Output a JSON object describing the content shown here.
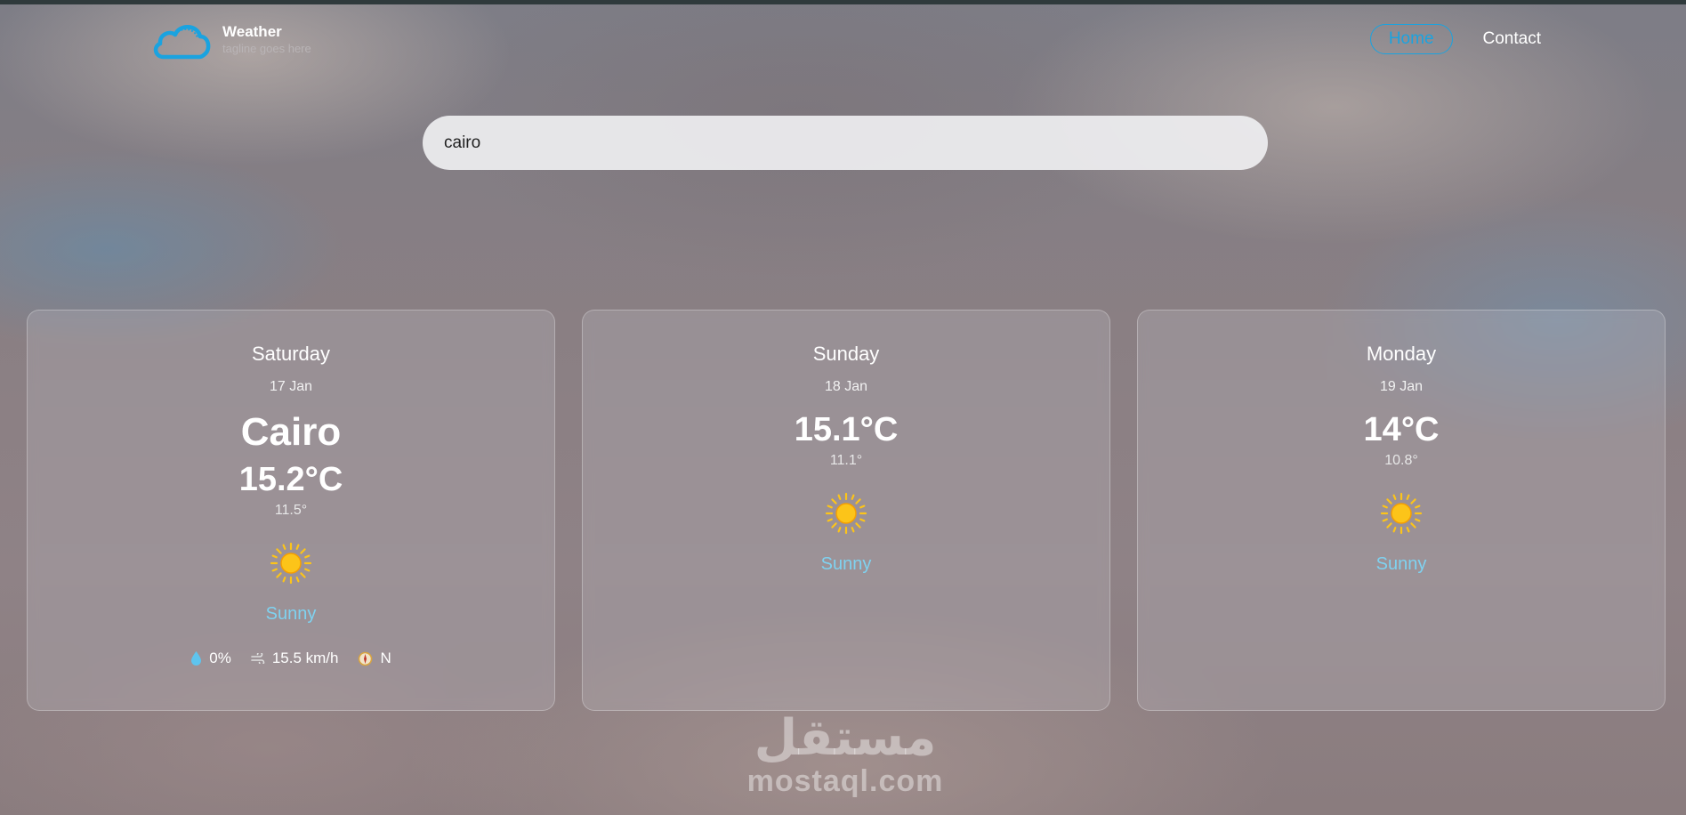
{
  "header": {
    "brand_title": "Weather",
    "brand_tagline": "tagline goes here",
    "nav": [
      {
        "label": "Home",
        "active": true
      },
      {
        "label": "Contact",
        "active": false
      }
    ]
  },
  "search": {
    "value": "cairo"
  },
  "today": {
    "day": "Saturday",
    "date": "17 Jan",
    "city": "Cairo",
    "temp_max": "15.2°C",
    "temp_min": "11.5°",
    "condition": "Sunny",
    "icon": "sun-icon",
    "rain": "0%",
    "wind": "15.5 km/h",
    "wind_direction": "N"
  },
  "forecast": [
    {
      "day": "Sunday",
      "date": "18 Jan",
      "temp_max": "15.1°C",
      "temp_min": "11.1°",
      "condition": "Sunny",
      "icon": "sun-icon"
    },
    {
      "day": "Monday",
      "date": "19 Jan",
      "temp_max": "14°C",
      "temp_min": "10.8°",
      "condition": "Sunny",
      "icon": "sun-icon"
    }
  ],
  "watermark": {
    "arabic": "مستقل",
    "latin": "mostaql.com"
  },
  "colors": {
    "accent": "#1aa3e0",
    "condition": "#7fd2f0",
    "sun": "#fcc419"
  }
}
